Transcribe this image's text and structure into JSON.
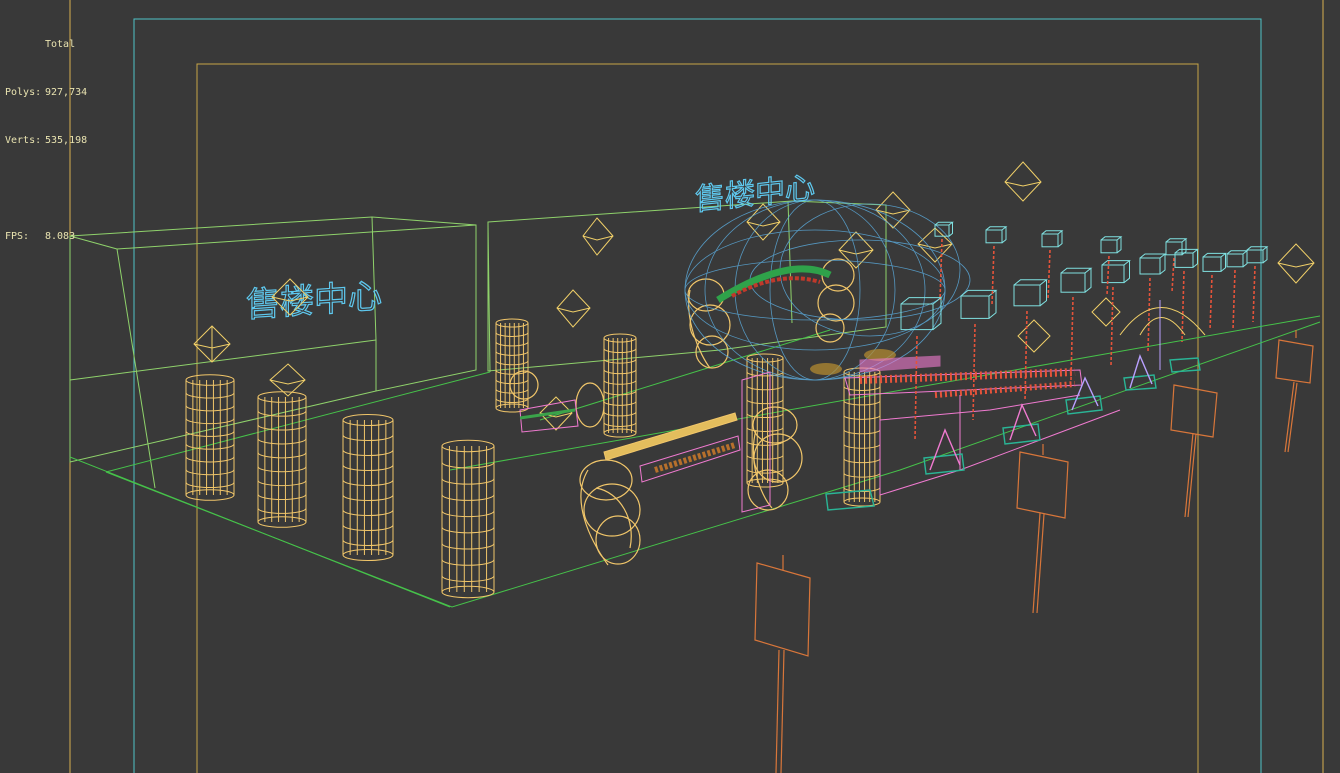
{
  "viewport": {
    "background": "#393939",
    "safe_frame_outer_color": "#4fc3c8",
    "safe_frame_inner_color": "#c8a546",
    "live_area_color": "#d6b04e"
  },
  "stats": {
    "title": "Total",
    "polys_label": "Polys:",
    "polys_value": "927,734",
    "verts_label": "Verts:",
    "verts_value": "535,198",
    "fps_label": "FPS:",
    "fps_value": "8.083"
  },
  "scene": {
    "sign_text_left": "售楼中心",
    "sign_text_center": "售楼中心",
    "colors": {
      "walls": "#8fd26b",
      "floor_lines": "#46c24a",
      "columns": "#f1c66a",
      "sign_text": "#5ec8ee",
      "helpers": "#f0cf68",
      "lamps": "#7fe0e0",
      "lamp_poles": "#e5533a",
      "boards": "#d8763a",
      "benches": "#f07ad0",
      "bases": "#2ab596",
      "sphere": "#5aa8d8"
    }
  }
}
